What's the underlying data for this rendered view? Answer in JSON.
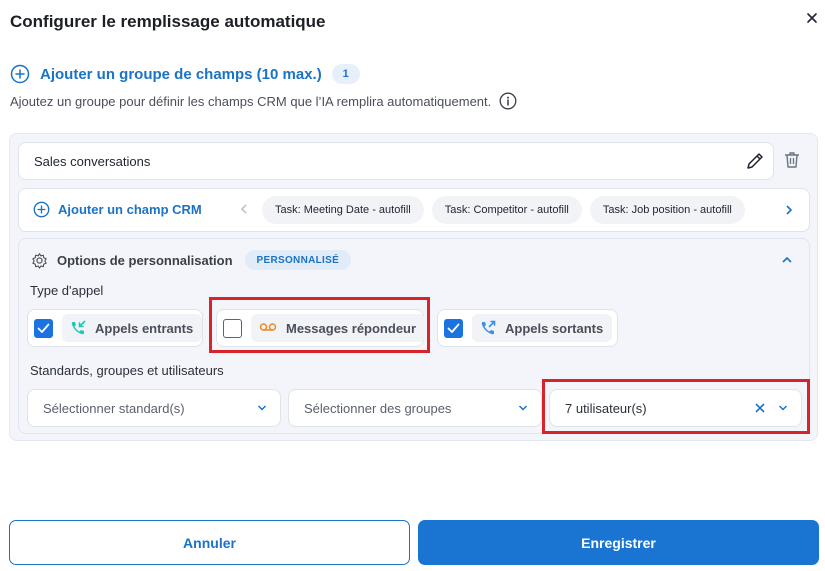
{
  "dialog": {
    "title": "Configurer le remplissage automatique",
    "close_icon": "close-icon"
  },
  "add_group": {
    "label": "Ajouter un groupe de champs (10 max.)",
    "count": "1",
    "description": "Ajoutez un groupe pour définir les champs CRM que l’IA remplira automatiquement."
  },
  "group": {
    "name": "Sales conversations",
    "add_crm_label": "Ajouter un champ CRM",
    "crm_fields": [
      "Task: Meeting Date - autofill",
      "Task: Competitor - autofill",
      "Task: Job position - autofill"
    ]
  },
  "options": {
    "title": "Options de personnalisation",
    "tag": "PERSONNALISÉ",
    "call_type_label": "Type d'appel",
    "call_types": [
      {
        "label": "Appels entrants",
        "checked": true,
        "icon": "incoming-call-icon",
        "color": "#1fc8b4"
      },
      {
        "label": "Messages répondeur",
        "checked": false,
        "icon": "voicemail-icon",
        "color": "#f08a24"
      },
      {
        "label": "Appels sortants",
        "checked": true,
        "icon": "outgoing-call-icon",
        "color": "#3a8fe6"
      }
    ],
    "targets_label": "Standards, groupes et utilisateurs",
    "selects": [
      {
        "placeholder": "Sélectionner standard(s)"
      },
      {
        "placeholder": "Sélectionner des groupes"
      },
      {
        "value": "7 utilisateur(s)"
      }
    ]
  },
  "footer": {
    "cancel_label": "Annuler",
    "save_label": "Enregistrer"
  },
  "colors": {
    "accent": "#1a73c7",
    "primary_button": "#1a75d2",
    "highlight": "#d9232b"
  }
}
